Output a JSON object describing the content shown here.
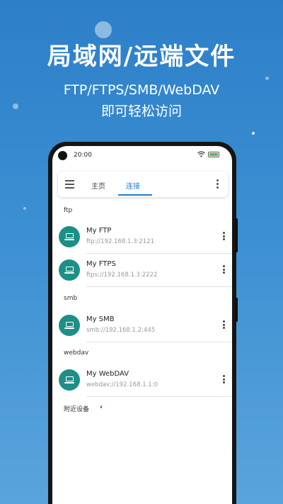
{
  "headline": "局域网/远端文件",
  "subline_protocols": "FTP/FTPS/SMB/WebDAV",
  "subline_tagline": "即可轻松访问",
  "status_bar": {
    "time": "20:00"
  },
  "app_bar": {
    "tabs": [
      {
        "label": "主页",
        "active": false
      },
      {
        "label": "连接",
        "active": true
      }
    ]
  },
  "sections": [
    {
      "label": "ftp",
      "connections": [
        {
          "name": "My FTP",
          "url": "ftp://192.168.1.3:2121"
        },
        {
          "name": "My FTPS",
          "url": "ftps://192.168.1.3:2222"
        }
      ]
    },
    {
      "label": "smb",
      "connections": [
        {
          "name": "My SMB",
          "url": "smb://192.168.1.2:445"
        }
      ]
    },
    {
      "label": "webdav",
      "connections": [
        {
          "name": "My WebDAV",
          "url": "webdav://192.168.1.1:0"
        }
      ]
    }
  ],
  "nearby_label": "附近设备",
  "colors": {
    "background_top": "#2d7fc8",
    "background_bottom": "#5aa4dc",
    "accent": "#1c7fd0",
    "avatar": "#1d8f86",
    "battery": "#4bc04b",
    "nearby_marker": "#e53935"
  },
  "icons": {
    "menu": "hamburger-menu-icon",
    "overflow": "more-vertical-icon",
    "connection": "laptop-icon",
    "wifi": "wifi-icon",
    "battery": "battery-icon"
  }
}
